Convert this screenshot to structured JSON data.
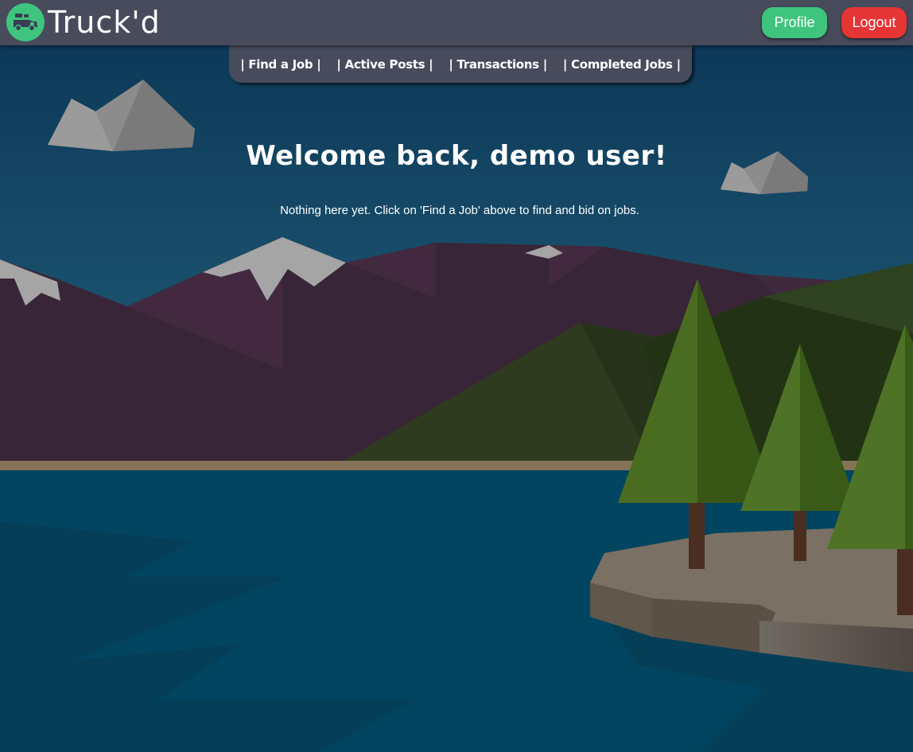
{
  "app": {
    "name": "Truck'd"
  },
  "header": {
    "logo_icon": "truck-icon",
    "profile_label": "Profile",
    "logout_label": "Logout"
  },
  "nav": {
    "items": [
      {
        "label": "| Find a Job |"
      },
      {
        "label": "| Active Posts |"
      },
      {
        "label": "| Transactions |"
      },
      {
        "label": "| Completed Jobs |"
      }
    ]
  },
  "main": {
    "welcome": "Welcome back, demo user!",
    "empty_message": "Nothing here yet. Click on 'Find a Job' above to find and bid on jobs."
  },
  "colors": {
    "header_bg": "#474b5c",
    "profile": "#3ec47c",
    "logout": "#e53535",
    "sky_top": "#0d3a5a",
    "lake": "#024560"
  }
}
